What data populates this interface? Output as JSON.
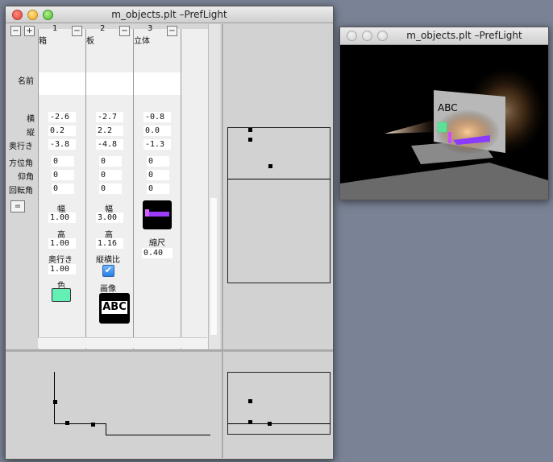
{
  "main_window": {
    "title": "m_objects.plt –PrefLight",
    "minus": "−",
    "plus": "+",
    "equal_button": "=",
    "row_labels": {
      "name": "名前",
      "x": "横",
      "y": "縦",
      "z": "奥行き",
      "azimuth": "方位角",
      "elevation": "仰角",
      "rotation": "回転角"
    },
    "columns": [
      {
        "number": "1",
        "name": "箱",
        "x": "-2.6",
        "y": "0.2",
        "z": "-3.8",
        "azimuth": "0",
        "elevation": "0",
        "rotation": "0",
        "width_label": "幅",
        "width": "1.00",
        "height_label": "高",
        "height": "1.00",
        "depth_label": "奥行き",
        "depth": "1.00",
        "color_label": "色",
        "color": "#62f0b4"
      },
      {
        "number": "2",
        "name": "板",
        "x": "-2.7",
        "y": "2.2",
        "z": "-4.8",
        "azimuth": "0",
        "elevation": "0",
        "rotation": "0",
        "width_label": "幅",
        "width": "3.00",
        "height_label": "高",
        "height": "1.16",
        "aspect_label": "縦横比",
        "aspect_checked": true,
        "image_label": "画像",
        "image_text": "ABC"
      },
      {
        "number": "3",
        "name": "立体",
        "x": "-0.8",
        "y": "0.0",
        "z": "-1.3",
        "azimuth": "0",
        "elevation": "0",
        "rotation": "0",
        "scale_label": "縮尺",
        "scale": "0.40"
      }
    ]
  },
  "preview_window": {
    "title": "m_objects.plt –PrefLight",
    "scene_text": "ABC"
  }
}
